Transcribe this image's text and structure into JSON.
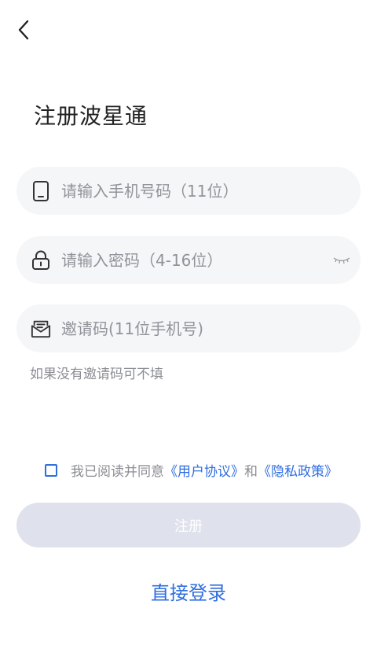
{
  "header": {
    "back_icon": "chevron-left-icon",
    "title": "注册波星通"
  },
  "form": {
    "phone": {
      "icon": "phone-icon",
      "placeholder": "请输入手机号码（11位）",
      "value": ""
    },
    "password": {
      "icon": "lock-icon",
      "placeholder": "请输入密码（4-16位）",
      "value": "",
      "toggle_icon": "eye-closed-icon"
    },
    "invite": {
      "icon": "message-icon",
      "placeholder": "邀请码(11位手机号)",
      "value": ""
    },
    "invite_hint": "如果没有邀请码可不填"
  },
  "agreement": {
    "checked": false,
    "prefix": "我已阅读并同意",
    "user_agreement": "《用户协议》",
    "conjunction": "和",
    "privacy_policy": "《隐私政策》"
  },
  "actions": {
    "submit_label": "注册",
    "login_link": "直接登录"
  },
  "colors": {
    "accent": "#2f6ee0",
    "submit_disabled": "#dfe1ec",
    "field_bg": "#f5f6f8",
    "hint_text": "#8a8d93"
  }
}
